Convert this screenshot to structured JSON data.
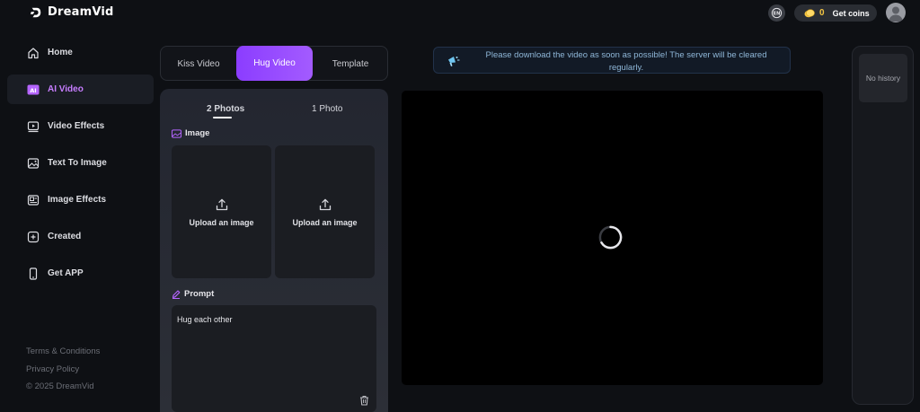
{
  "header": {
    "app_name": "DreamVid",
    "coin_count": "0",
    "get_coins_label": "Get coins"
  },
  "sidebar": {
    "items": [
      {
        "label": "Home",
        "icon": "home-icon"
      },
      {
        "label": "AI Video",
        "icon": "ai-badge-icon",
        "active": true
      },
      {
        "label": "Video Effects",
        "icon": "video-play-icon"
      },
      {
        "label": "Text To Image",
        "icon": "image-icon"
      },
      {
        "label": "Image Effects",
        "icon": "image-effects-icon"
      },
      {
        "label": "Created",
        "icon": "add-square-icon"
      },
      {
        "label": "Get APP",
        "icon": "phone-icon"
      }
    ],
    "footer": {
      "terms": "Terms & Conditions",
      "privacy": "Privacy Policy",
      "copyright": "© 2025 DreamVid"
    }
  },
  "mode_tabs": {
    "kiss": "Kiss Video",
    "hug": "Hug Video",
    "template": "Template",
    "active": "hug"
  },
  "panel": {
    "photo_tabs": {
      "two": "2 Photos",
      "one": "1 Photo",
      "active": "two"
    },
    "image_label": "Image",
    "upload_label_1": "Upload an image",
    "upload_label_2": "Upload an image",
    "prompt_label": "Prompt",
    "prompt_value": "Hug each other"
  },
  "notice": {
    "text": "Please download the video as soon as possible! The server will be cleared regularly."
  },
  "history": {
    "empty_label": "No history"
  },
  "colors": {
    "accent": "#a35bff",
    "background": "#0e1014",
    "notice_text": "#8fb7d8"
  }
}
